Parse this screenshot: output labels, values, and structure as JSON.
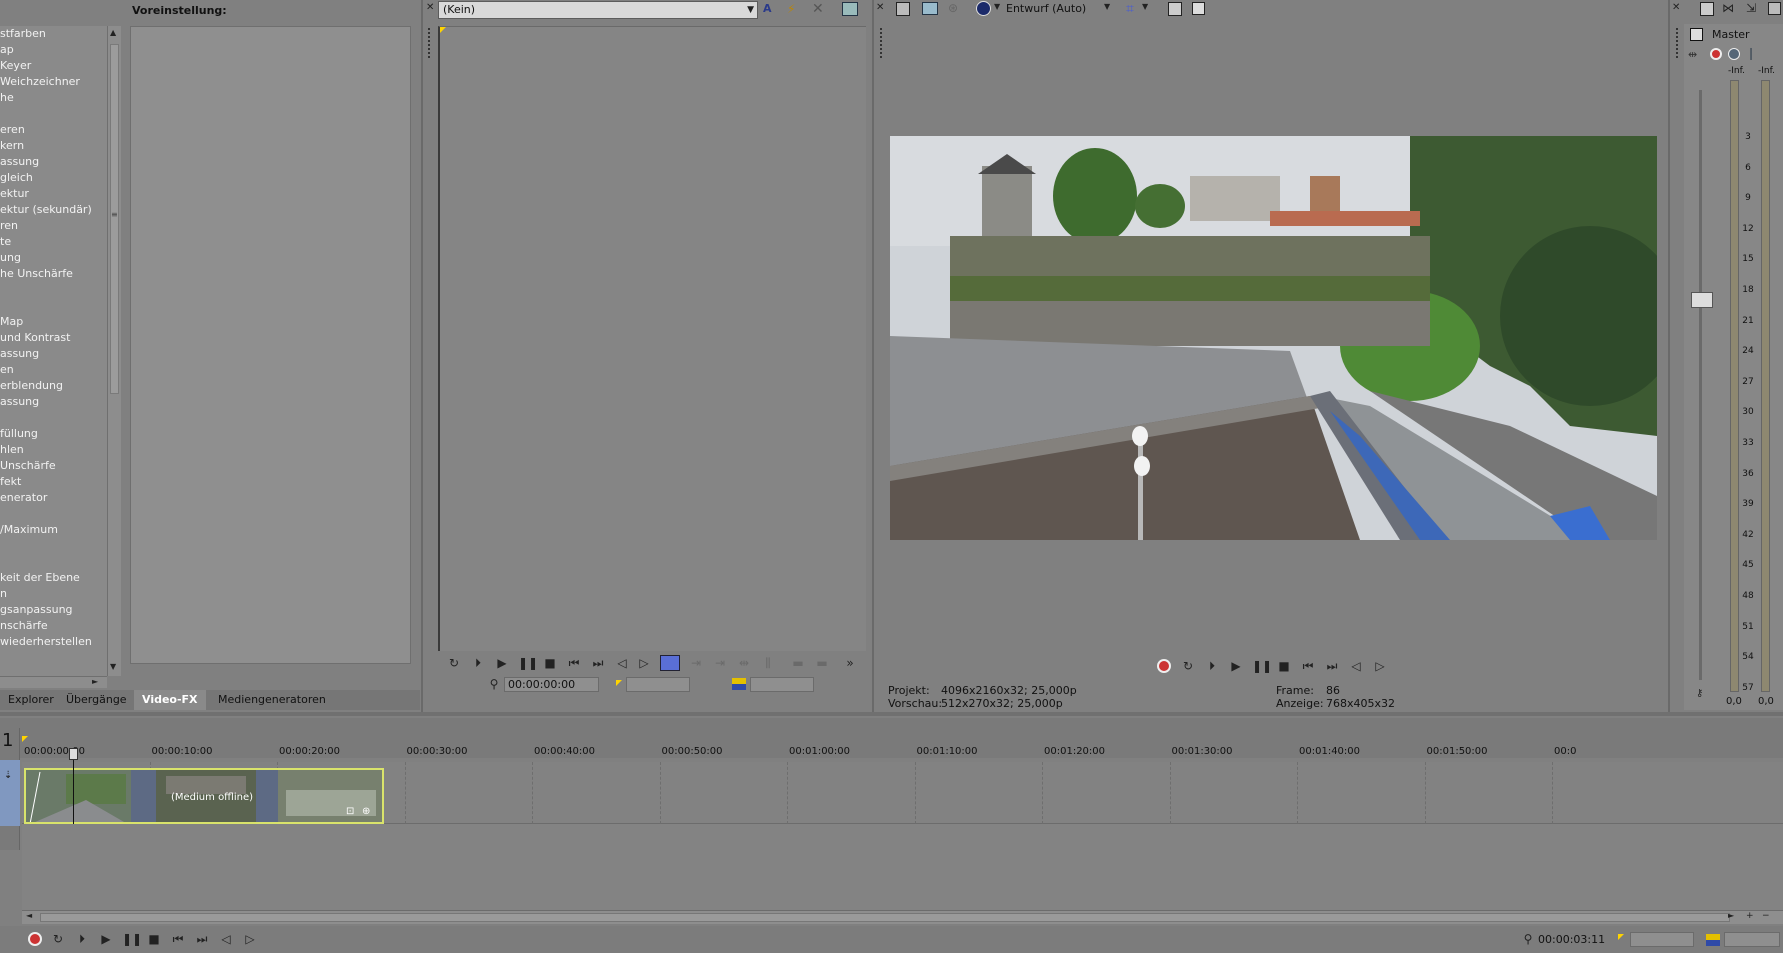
{
  "fx_list": {
    "items": [
      "stfarben",
      "ap",
      "Keyer",
      "Weichzeichner",
      "he",
      "",
      "eren",
      "kern",
      "assung",
      "gleich",
      "ektur",
      "ektur (sekundär)",
      "ren",
      "te",
      "ung",
      "he Unschärfe",
      "",
      "",
      "Map",
      "und Kontrast",
      "assung",
      "en",
      "erblendung",
      "assung",
      "",
      "füllung",
      "hlen",
      "Unschärfe",
      "fekt",
      "enerator",
      "",
      "/Maximum",
      "",
      "",
      "keit der Ebene",
      "n",
      "gsanpassung",
      "nschärfe",
      "wiederherstellen"
    ]
  },
  "tabs": [
    "Explorer",
    "Übergänge",
    "Video-FX",
    "Mediengeneratoren"
  ],
  "preset": {
    "title": "Voreinstellung:"
  },
  "trimmer": {
    "select_value": "(Kein)",
    "timecode": "00:00:00:00"
  },
  "preview": {
    "quality": "Entwurf (Auto)",
    "projekt_label": "Projekt:",
    "projekt_value": "4096x2160x32; 25,000p",
    "vorschau_label": "Vorschau:",
    "vorschau_value": "512x270x32; 25,000p",
    "frame_label": "Frame:",
    "frame_value": "86",
    "anzeige_label": "Anzeige:",
    "anzeige_value": "768x405x32"
  },
  "master": {
    "label": "Master",
    "peak_left": "-Inf.",
    "peak_right": "-Inf.",
    "scale": [
      "3",
      "6",
      "9",
      "12",
      "15",
      "18",
      "21",
      "24",
      "27",
      "30",
      "33",
      "36",
      "39",
      "42",
      "45",
      "48",
      "51",
      "54",
      "57"
    ],
    "value_left": "0,0",
    "value_right": "0,0"
  },
  "timeline": {
    "track_number": "1",
    "ruler": [
      "00:00:00:00",
      "00:00:10:00",
      "00:00:20:00",
      "00:00:30:00",
      "00:00:40:00",
      "00:00:50:00",
      "00:01:00:00",
      "00:01:10:00",
      "00:01:20:00",
      "00:01:30:00",
      "00:01:40:00",
      "00:01:50:00",
      "00:0"
    ],
    "clip_label": "(Medium offline)",
    "end_time": "00:00:03:11"
  }
}
